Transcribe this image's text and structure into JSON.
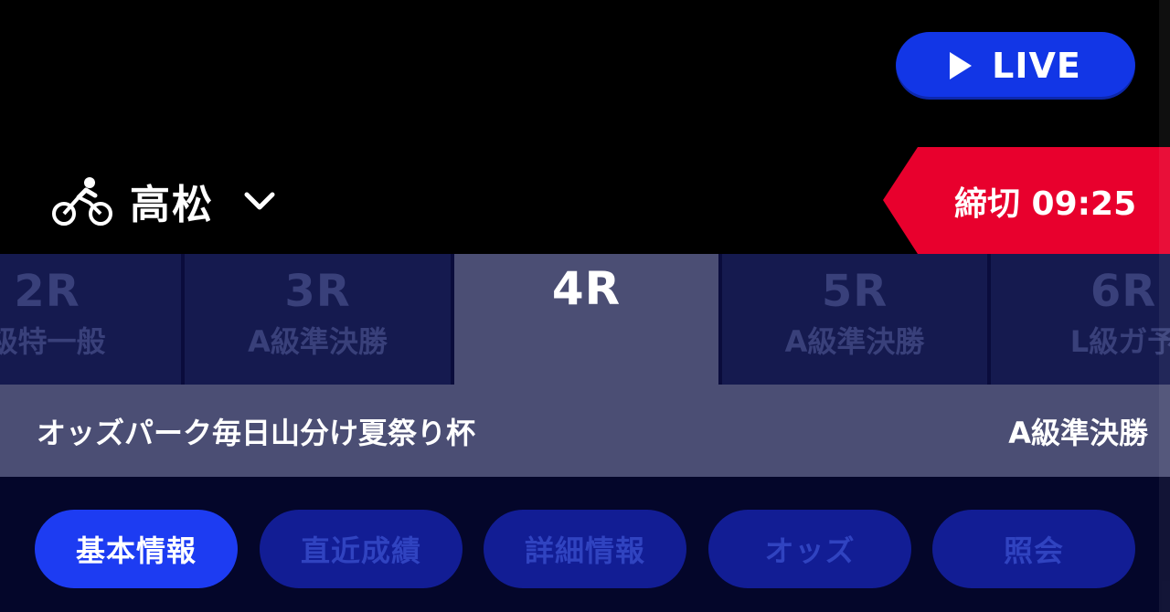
{
  "live_button": {
    "label": "LIVE",
    "icon": "play-icon"
  },
  "venue": {
    "icon": "bicycle-icon",
    "name": "高松",
    "dropdown_icon": "chevron-down-icon"
  },
  "deadline": {
    "text": "締切 09:25",
    "color": "#e8002d"
  },
  "race_tabs": [
    {
      "number": "2R",
      "class": "級特一般"
    },
    {
      "number": "3R",
      "class": "A級準決勝"
    },
    {
      "number": "4R",
      "class": "",
      "active": true
    },
    {
      "number": "5R",
      "class": "A級準決勝"
    },
    {
      "number": "6R",
      "class": "L級ガ予"
    }
  ],
  "race": {
    "title": "オッズパーク毎日山分け夏祭り杯",
    "class": "A級準決勝"
  },
  "info_tabs": [
    {
      "label": "基本情報",
      "active": true
    },
    {
      "label": "直近成績"
    },
    {
      "label": "詳細情報"
    },
    {
      "label": "オッズ"
    },
    {
      "label": "照会"
    }
  ],
  "colors": {
    "accent": "#1d3cf2",
    "live": "#1236e6",
    "panel": "#4b4e74"
  }
}
